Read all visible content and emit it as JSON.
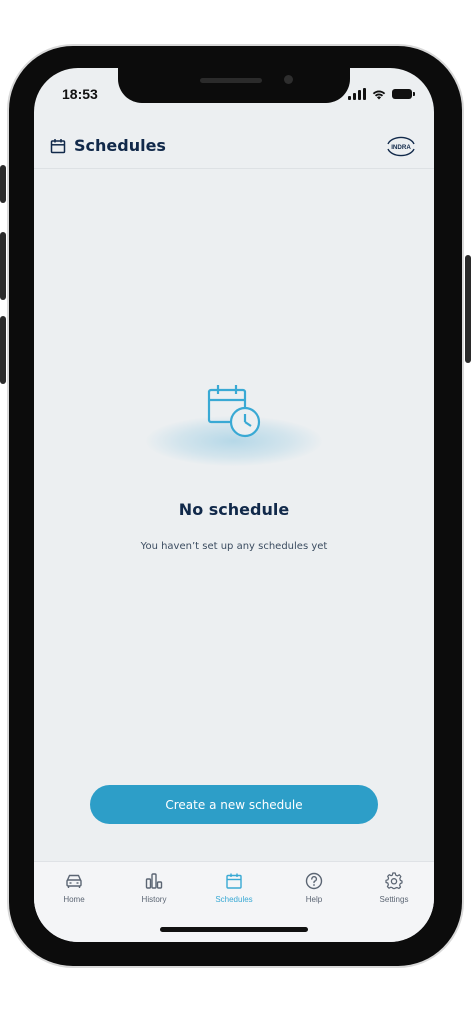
{
  "status_bar": {
    "time": "18:53"
  },
  "header": {
    "title": "Schedules",
    "logo_text": "INDRA"
  },
  "empty_state": {
    "title": "No schedule",
    "subtitle": "You haven’t set up any schedules yet"
  },
  "create_button": {
    "label": "Create a new schedule"
  },
  "tabs": [
    {
      "label": "Home",
      "icon": "car-icon",
      "active": false
    },
    {
      "label": "History",
      "icon": "bar-chart-icon",
      "active": false
    },
    {
      "label": "Schedules",
      "icon": "calendar-icon",
      "active": true
    },
    {
      "label": "Help",
      "icon": "help-circle-icon",
      "active": false
    },
    {
      "label": "Settings",
      "icon": "gear-icon",
      "active": false
    }
  ],
  "colors": {
    "accent": "#2d9ec8",
    "active_tab": "#39a9d4",
    "title_text": "#11294a",
    "background": "#eceff1"
  }
}
